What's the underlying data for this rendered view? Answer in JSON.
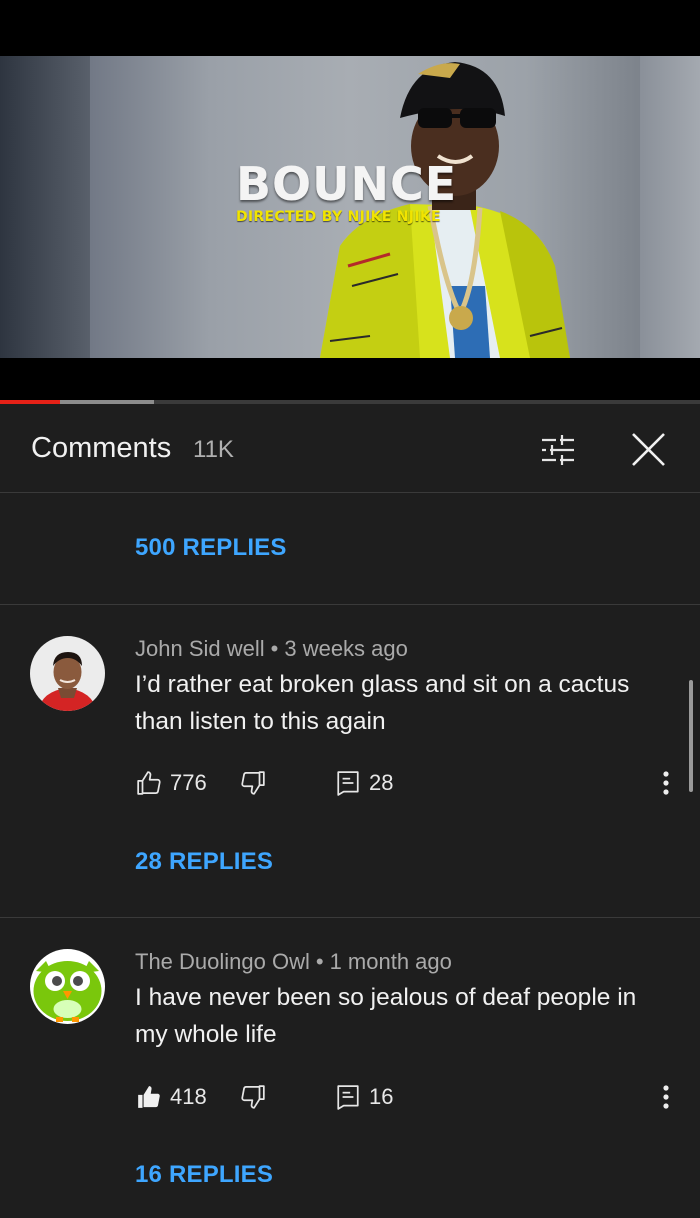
{
  "video": {
    "title": "BOUNCE",
    "subtitle": "DIRECTED BY NJIKE NJIKE",
    "progress_played": 0.085,
    "progress_buffered": 0.22
  },
  "comments_panel": {
    "title": "Comments",
    "count": "11K",
    "icons": {
      "sort": "sort-sliders-icon",
      "close": "close-icon"
    }
  },
  "prev_thread": {
    "replies_label": "500 REPLIES"
  },
  "comments": [
    {
      "author": "John Sid well",
      "time": "3 weeks ago",
      "text": "I’d rather eat broken glass and sit on a cactus than listen to this again",
      "likes": "776",
      "replies_count": "28",
      "replies_label": "28 REPLIES",
      "liked": false,
      "avatar_bg": "#e9e9e9"
    },
    {
      "author": "The Duolingo Owl",
      "time": "1 month ago",
      "text": "I have never been so jealous of deaf people in my whole life",
      "likes": "418",
      "replies_count": "16",
      "replies_label": "16 REPLIES",
      "liked": true,
      "avatar_bg": "#ffffff"
    }
  ],
  "colors": {
    "link": "#3ea6ff",
    "panel_bg": "#1e1e1e",
    "progress_played": "#e62117",
    "subtitle": "#f1e400"
  }
}
